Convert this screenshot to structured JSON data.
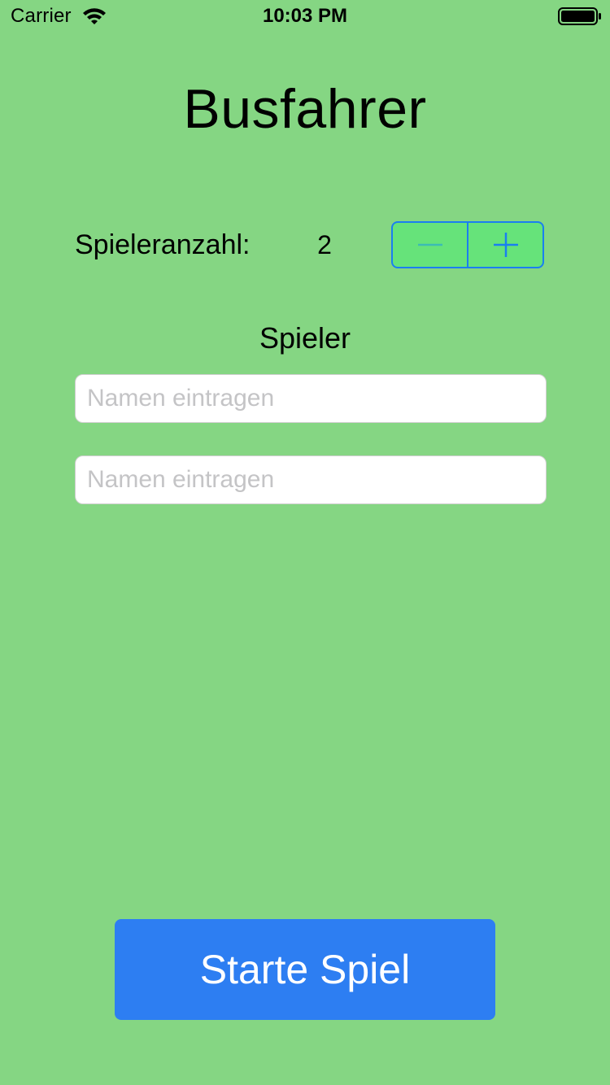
{
  "status_bar": {
    "carrier": "Carrier",
    "time": "10:03 PM",
    "wifi_icon": "wifi-icon",
    "battery_icon": "battery-icon"
  },
  "title": "Busfahrer",
  "player_count": {
    "label": "Spieleranzahl:",
    "value": "2",
    "stepper": {
      "decrement_icon": "minus-icon",
      "increment_icon": "plus-icon"
    }
  },
  "players": {
    "heading": "Spieler",
    "fields": [
      {
        "value": "",
        "placeholder": "Namen eintragen"
      },
      {
        "value": "",
        "placeholder": "Namen eintragen"
      }
    ]
  },
  "start_button": {
    "label": "Starte Spiel"
  },
  "colors": {
    "background": "#85d683",
    "accent": "#1a7ff0",
    "stepper_fill": "#66e37a",
    "button": "#2d7ef2"
  }
}
